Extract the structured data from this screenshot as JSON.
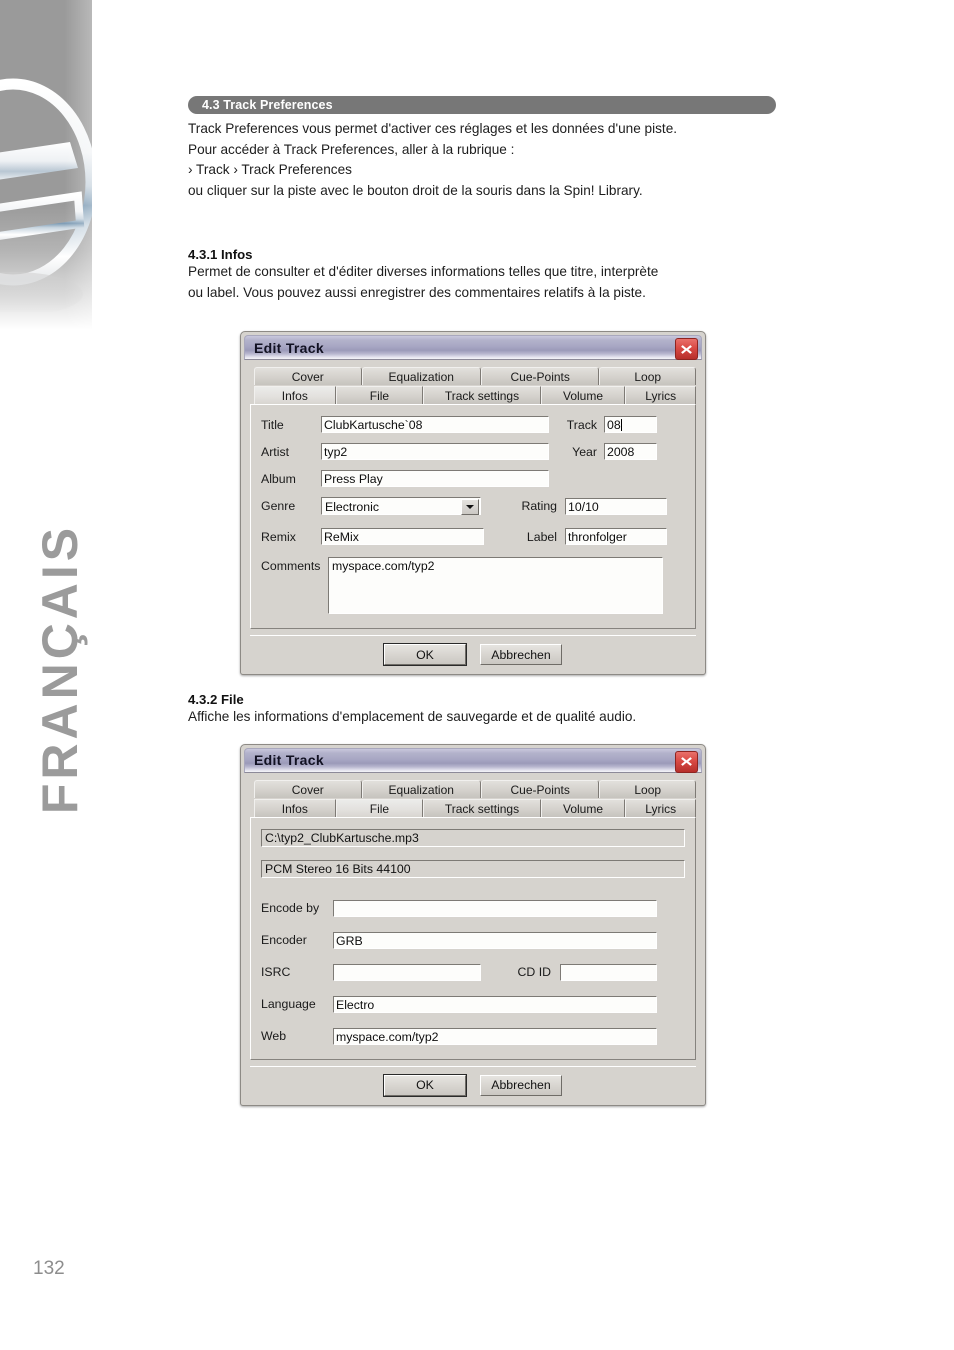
{
  "page": {
    "number": "132",
    "language_tab": "FRANÇAIS",
    "logo": "metallic-e-logo"
  },
  "section": {
    "bar_title": "4.3 Track Preferences",
    "intro_lines": [
      "Track Preferences vous permet d'activer ces réglages et les données d'une piste.",
      "Pour accéder à Track Preferences, aller à la rubrique :",
      " › Track › Track Preferences",
      "ou cliquer sur la piste avec le bouton droit de la souris dans la Spin! Library."
    ]
  },
  "sub_sections": [
    {
      "heading": "4.3.1 Infos",
      "lines": [
        "Permet de consulter et d'éditer diverses informations telles que titre, interprète",
        "ou label. Vous pouvez aussi enregistrer des commentaires relatifs à la piste."
      ]
    },
    {
      "heading": "4.3.2 File",
      "lines": [
        "Affiche les informations d'emplacement de sauvegarde et de qualité audio."
      ]
    }
  ],
  "dialog_infos": {
    "title": "Edit Track",
    "close_icon": "close-x-icon",
    "tabs_top": [
      "Cover",
      "Equalization",
      "Cue-Points",
      "Loop"
    ],
    "tabs_bottom": [
      "Infos",
      "File",
      "Track settings",
      "Volume",
      "Lyrics"
    ],
    "active_tab": "Infos",
    "fields": {
      "title_label": "Title",
      "title_value": "ClubKartusche`08",
      "track_label": "Track",
      "track_value": "08",
      "artist_label": "Artist",
      "artist_value": "typ2",
      "year_label": "Year",
      "year_value": "2008",
      "album_label": "Album",
      "album_value": "Press Play",
      "genre_label": "Genre",
      "genre_value": "Electronic",
      "genre_arrow_icon": "chevron-down-icon",
      "rating_label": "Rating",
      "rating_value": "10/10",
      "remix_label": "Remix",
      "remix_value": "ReMix",
      "label_label": "Label",
      "label_value": "thronfolger",
      "comments_label": "Comments",
      "comments_value": "myspace.com/typ2"
    },
    "buttons": {
      "ok": "OK",
      "cancel": "Abbrechen"
    }
  },
  "dialog_file": {
    "title": "Edit Track",
    "close_icon": "close-x-icon",
    "tabs_top": [
      "Cover",
      "Equalization",
      "Cue-Points",
      "Loop"
    ],
    "tabs_bottom": [
      "Infos",
      "File",
      "Track settings",
      "Volume",
      "Lyrics"
    ],
    "active_tab": "File",
    "fields": {
      "path_value": "C:\\typ2_ClubKartusche.mp3",
      "format_value": "PCM Stereo  16 Bits  44100",
      "encode_by_label": "Encode by",
      "encode_by_value": "",
      "encoder_label": "Encoder",
      "encoder_value": "GRB",
      "isrc_label": "ISRC",
      "isrc_value": "",
      "cdid_label": "CD ID",
      "cdid_value": "",
      "language_label": "Language",
      "language_value": "Electro",
      "web_label": "Web",
      "web_value": "myspace.com/typ2"
    },
    "buttons": {
      "ok": "OK",
      "cancel": "Abbrechen"
    }
  },
  "colors": {
    "section_bar": "#777777",
    "band_gray": "#9a9a9a",
    "lang_gray": "#9b9b9b",
    "dialog_face": "#d6d3ce",
    "titlebar_purple": "#9b9ab9",
    "close_red": "#d94a44"
  }
}
